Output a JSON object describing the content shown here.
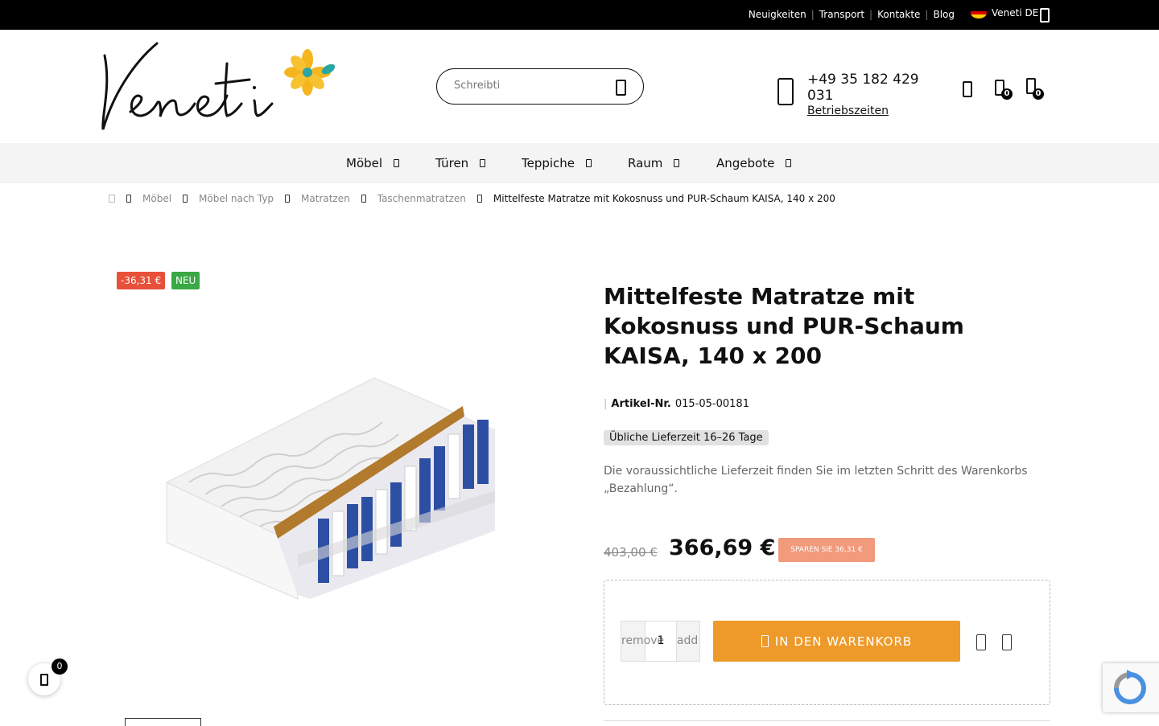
{
  "topbar": {
    "links": [
      "Neuigkeiten",
      "Transport",
      "Kontakte",
      "Blog"
    ],
    "language": "Veneti DE"
  },
  "header": {
    "logo_text": "Veneti",
    "search_placeholder": "Schreibti",
    "phone": "+49 35 182 429 031",
    "hours_link": "Betriebszeiten",
    "compare_count": "0",
    "cart_count": "0"
  },
  "nav": {
    "items": [
      "Möbel",
      "Türen",
      "Teppiche",
      "Raum",
      "Angebote"
    ]
  },
  "breadcrumb": [
    "Möbel",
    "Möbel nach Typ",
    "Matratzen",
    "Taschenmatratzen",
    "Mittelfeste Matratze mit Kokosnuss und PUR-Schaum KAISA, 140 x 200"
  ],
  "product": {
    "flag_sale": "-36,31 €",
    "flag_new": "NEU",
    "title": "Mittelfeste Matratze mit Kokosnuss und PUR-Schaum KAISA, 140 x 200",
    "sku_label": "Artikel-Nr.",
    "sku": "015-05-00181",
    "delivery": "Übliche Lieferzeit 16–26 Tage",
    "note": "Die voraussichtliche Lieferzeit finden Sie im letzten Schritt des Warenkorbs „Bezahlung“.",
    "old_price": "403,00 €",
    "price": "366,69 €",
    "save": "SPAREN SIE 36,31 €",
    "qty_minus": "remove",
    "qty_value": "1",
    "qty_plus": "add",
    "add_to_cart": "IN DEN WARENKORB"
  },
  "floating_cart": {
    "count": "0"
  },
  "colors": {
    "accent": "#ee9a2b",
    "sale": "#e8503a",
    "new": "#3aa845",
    "save_badge": "#f29a7c"
  }
}
